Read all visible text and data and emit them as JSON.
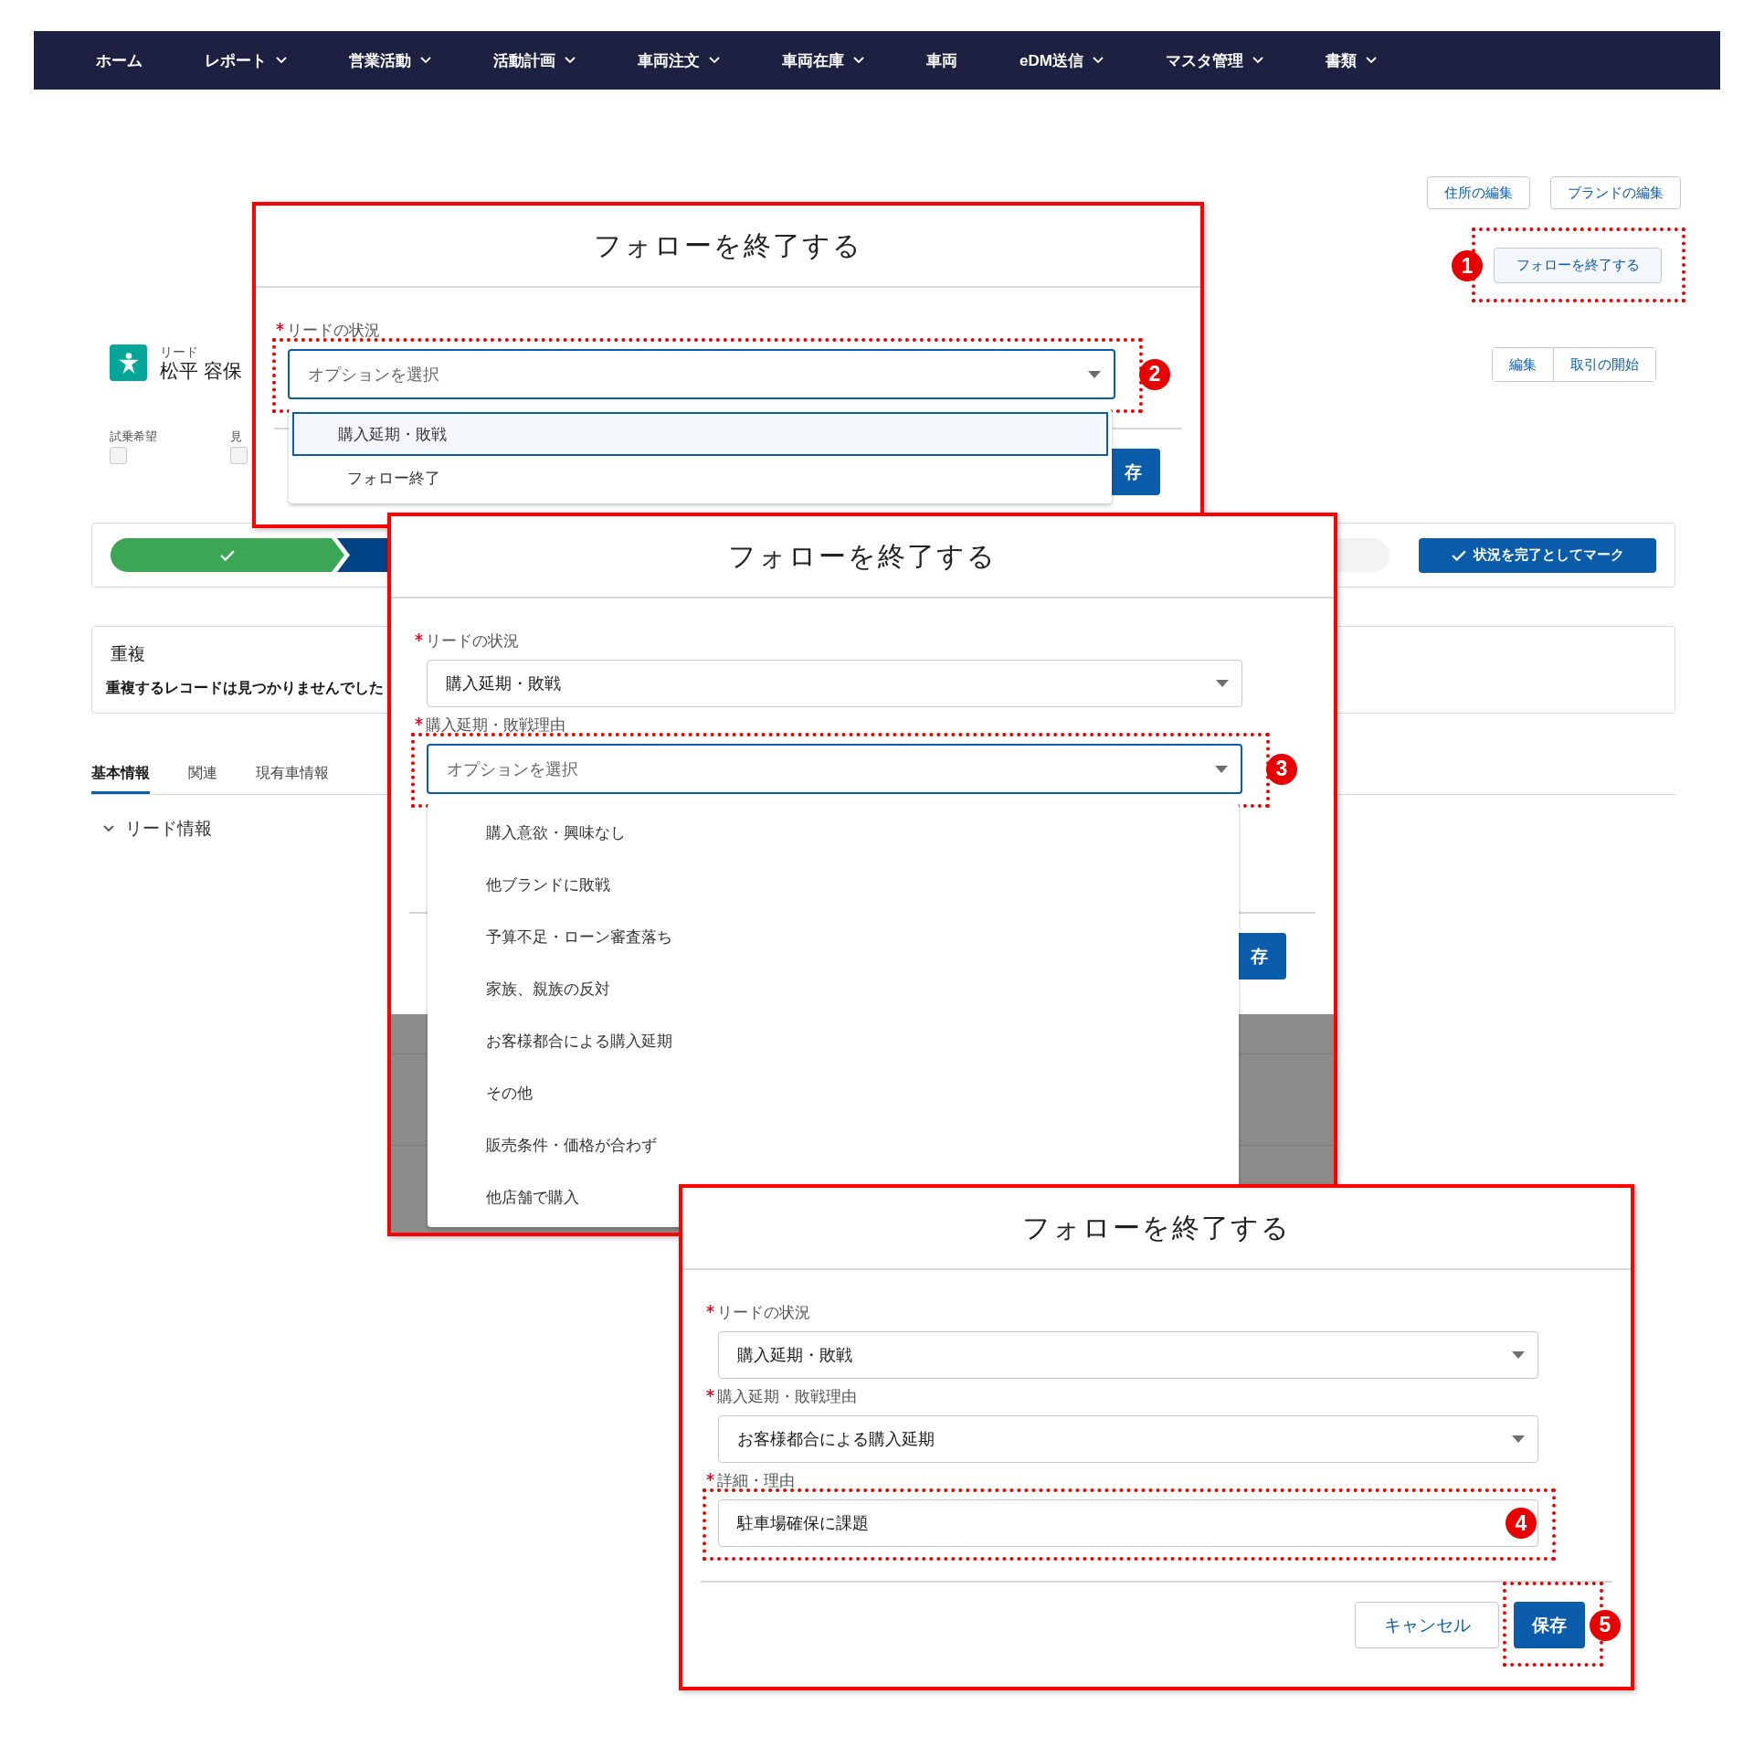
{
  "nav": [
    {
      "label": "ホーム",
      "has_menu": false
    },
    {
      "label": "レポート",
      "has_menu": true
    },
    {
      "label": "営業活動",
      "has_menu": true
    },
    {
      "label": "活動計画",
      "has_menu": true
    },
    {
      "label": "車両注文",
      "has_menu": true
    },
    {
      "label": "車両在庫",
      "has_menu": true
    },
    {
      "label": "車両",
      "has_menu": false
    },
    {
      "label": "eDM送信",
      "has_menu": true
    },
    {
      "label": "マスタ管理",
      "has_menu": true
    },
    {
      "label": "書類",
      "has_menu": true
    }
  ],
  "record": {
    "top_actions": [
      "住所の編集",
      "ブランドの編集"
    ],
    "follow_button": {
      "label": "フォローを終了する",
      "marker": "1"
    },
    "object_label": "リード",
    "name": "松平 容保",
    "actions": [
      "編集",
      "取引の開始"
    ],
    "fields": [
      {
        "label": "試乗希望",
        "checked": false
      },
      {
        "label": "見",
        "checked": false
      }
    ]
  },
  "path": {
    "stages": [
      {
        "kind": "complete"
      },
      {
        "kind": "current"
      },
      {
        "kind": "upcoming"
      }
    ],
    "mark_button": "状況を完了としてマーク"
  },
  "duplicates": {
    "title": "重複",
    "message": "重複するレコードは見つかりませんでした"
  },
  "tabs": [
    {
      "label": "基本情報",
      "selected": true
    },
    {
      "label": "関連",
      "selected": false
    },
    {
      "label": "現有車情報",
      "selected": false
    }
  ],
  "section": {
    "title": "リード情報",
    "expanded": true
  },
  "dialogs": [
    {
      "title": "フォローを終了する",
      "fields": [
        {
          "kind": "select",
          "label": "リードの状況",
          "required": true,
          "placeholder": "オプションを選択",
          "focused": true,
          "marker": "2",
          "options": [
            {
              "label": "購入延期・敗戦",
              "selected": true
            },
            {
              "label": "フォロー終了",
              "selected": false
            }
          ]
        }
      ],
      "buttons": [
        {
          "label": "存",
          "kind": "primary"
        }
      ]
    },
    {
      "title": "フォローを終了する",
      "fields": [
        {
          "kind": "select",
          "label": "リードの状況",
          "required": true,
          "value": "購入延期・敗戦",
          "focused": false
        },
        {
          "kind": "select",
          "label": "購入延期・敗戦理由",
          "required": true,
          "placeholder": "オプションを選択",
          "focused": true,
          "marker": "3",
          "options": [
            {
              "label": "購入意欲・興味なし",
              "selected": false
            },
            {
              "label": "他ブランドに敗戦",
              "selected": false
            },
            {
              "label": "予算不足・ローン審査落ち",
              "selected": false
            },
            {
              "label": "家族、親族の反対",
              "selected": false
            },
            {
              "label": "お客様都合による購入延期",
              "selected": false
            },
            {
              "label": "その他",
              "selected": false
            },
            {
              "label": "販売条件・価格が合わず",
              "selected": false
            },
            {
              "label": "他店舗で購入",
              "selected": false
            }
          ]
        }
      ],
      "buttons": [
        {
          "label": "存",
          "kind": "primary"
        }
      ]
    },
    {
      "title": "フォローを終了する",
      "fields": [
        {
          "kind": "select",
          "label": "リードの状況",
          "required": true,
          "value": "購入延期・敗戦",
          "focused": false
        },
        {
          "kind": "select",
          "label": "購入延期・敗戦理由",
          "required": true,
          "value": "お客様都合による購入延期",
          "focused": false
        },
        {
          "kind": "text",
          "label": "詳細・理由",
          "required": true,
          "value": "駐車場確保に課題",
          "focused": false,
          "marker": "4"
        }
      ],
      "buttons": [
        {
          "label": "キャンセル",
          "kind": "neutral"
        },
        {
          "label": "保存",
          "kind": "primary",
          "marker": "5"
        }
      ]
    }
  ]
}
